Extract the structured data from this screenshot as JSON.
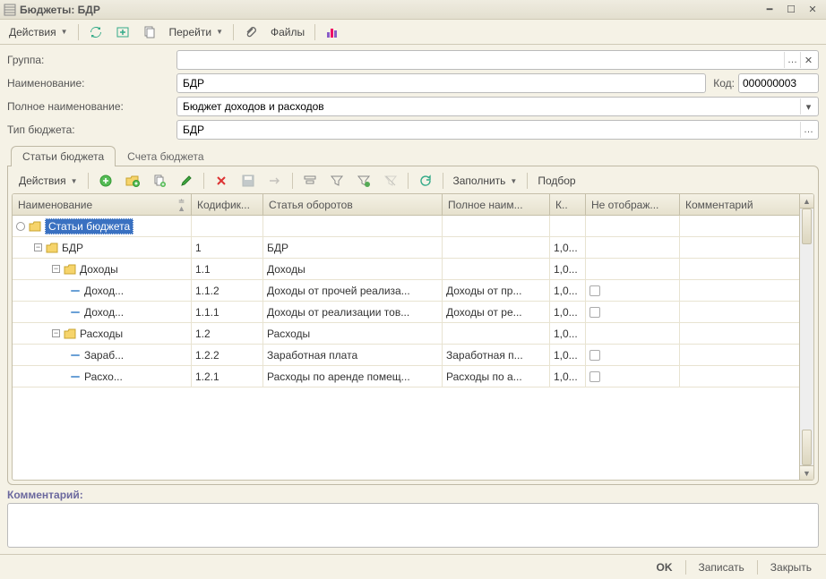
{
  "window": {
    "title": "Бюджеты: БДР"
  },
  "toolbar": {
    "actions": "Действия",
    "goto": "Перейти",
    "files": "Файлы"
  },
  "form": {
    "group_label": "Группа:",
    "group_value": "",
    "name_label": "Наименование:",
    "name_value": "БДР",
    "code_label": "Код:",
    "code_value": "000000003",
    "fullname_label": "Полное наименование:",
    "fullname_value": "Бюджет доходов и расходов",
    "type_label": "Тип бюджета:",
    "type_value": "БДР"
  },
  "tabs": {
    "items": "Статьи бюджета",
    "accounts": "Счета бюджета"
  },
  "subtoolbar": {
    "actions": "Действия",
    "fill": "Заполнить",
    "select": "Подбор"
  },
  "grid": {
    "col_name": "Наименование",
    "col_code": "Кодифик...",
    "col_stat": "Статья оборотов",
    "col_full": "Полное наим...",
    "col_k": "К..",
    "col_ne": "Не отображ...",
    "col_comm": "Комментарий",
    "rows": [
      {
        "indent": 0,
        "exp": "open",
        "folder": true,
        "radio": true,
        "sel": true,
        "name": "Статьи бюджета",
        "code": "",
        "stat": "",
        "full": "",
        "k": "",
        "cb": false
      },
      {
        "indent": 1,
        "exp": "open",
        "folder": true,
        "name": "БДР",
        "code": "1",
        "stat": "БДР",
        "full": "",
        "k": "1,0...",
        "cb": false
      },
      {
        "indent": 2,
        "exp": "open",
        "folder": true,
        "name": "Доходы",
        "code": "1.1",
        "stat": "Доходы",
        "full": "",
        "k": "1,0...",
        "cb": false
      },
      {
        "indent": 3,
        "exp": "",
        "folder": false,
        "name": "Доход...",
        "code": "1.1.2",
        "stat": "Доходы от прочей реализа...",
        "full": "Доходы от пр...",
        "k": "1,0...",
        "cb": true
      },
      {
        "indent": 3,
        "exp": "",
        "folder": false,
        "name": "Доход...",
        "code": "1.1.1",
        "stat": "Доходы от реализации тов...",
        "full": "Доходы от ре...",
        "k": "1,0...",
        "cb": true
      },
      {
        "indent": 2,
        "exp": "open",
        "folder": true,
        "name": "Расходы",
        "code": "1.2",
        "stat": "Расходы",
        "full": "",
        "k": "1,0...",
        "cb": false
      },
      {
        "indent": 3,
        "exp": "",
        "folder": false,
        "name": "Зараб...",
        "code": "1.2.2",
        "stat": "Заработная плата",
        "full": "Заработная п...",
        "k": "1,0...",
        "cb": true
      },
      {
        "indent": 3,
        "exp": "",
        "folder": false,
        "name": "Расхо...",
        "code": "1.2.1",
        "stat": "Расходы по аренде помещ...",
        "full": "Расходы по а...",
        "k": "1,0...",
        "cb": true
      }
    ]
  },
  "comment": {
    "label": "Комментарий:",
    "value": ""
  },
  "footer": {
    "ok": "OK",
    "save": "Записать",
    "close": "Закрыть"
  }
}
